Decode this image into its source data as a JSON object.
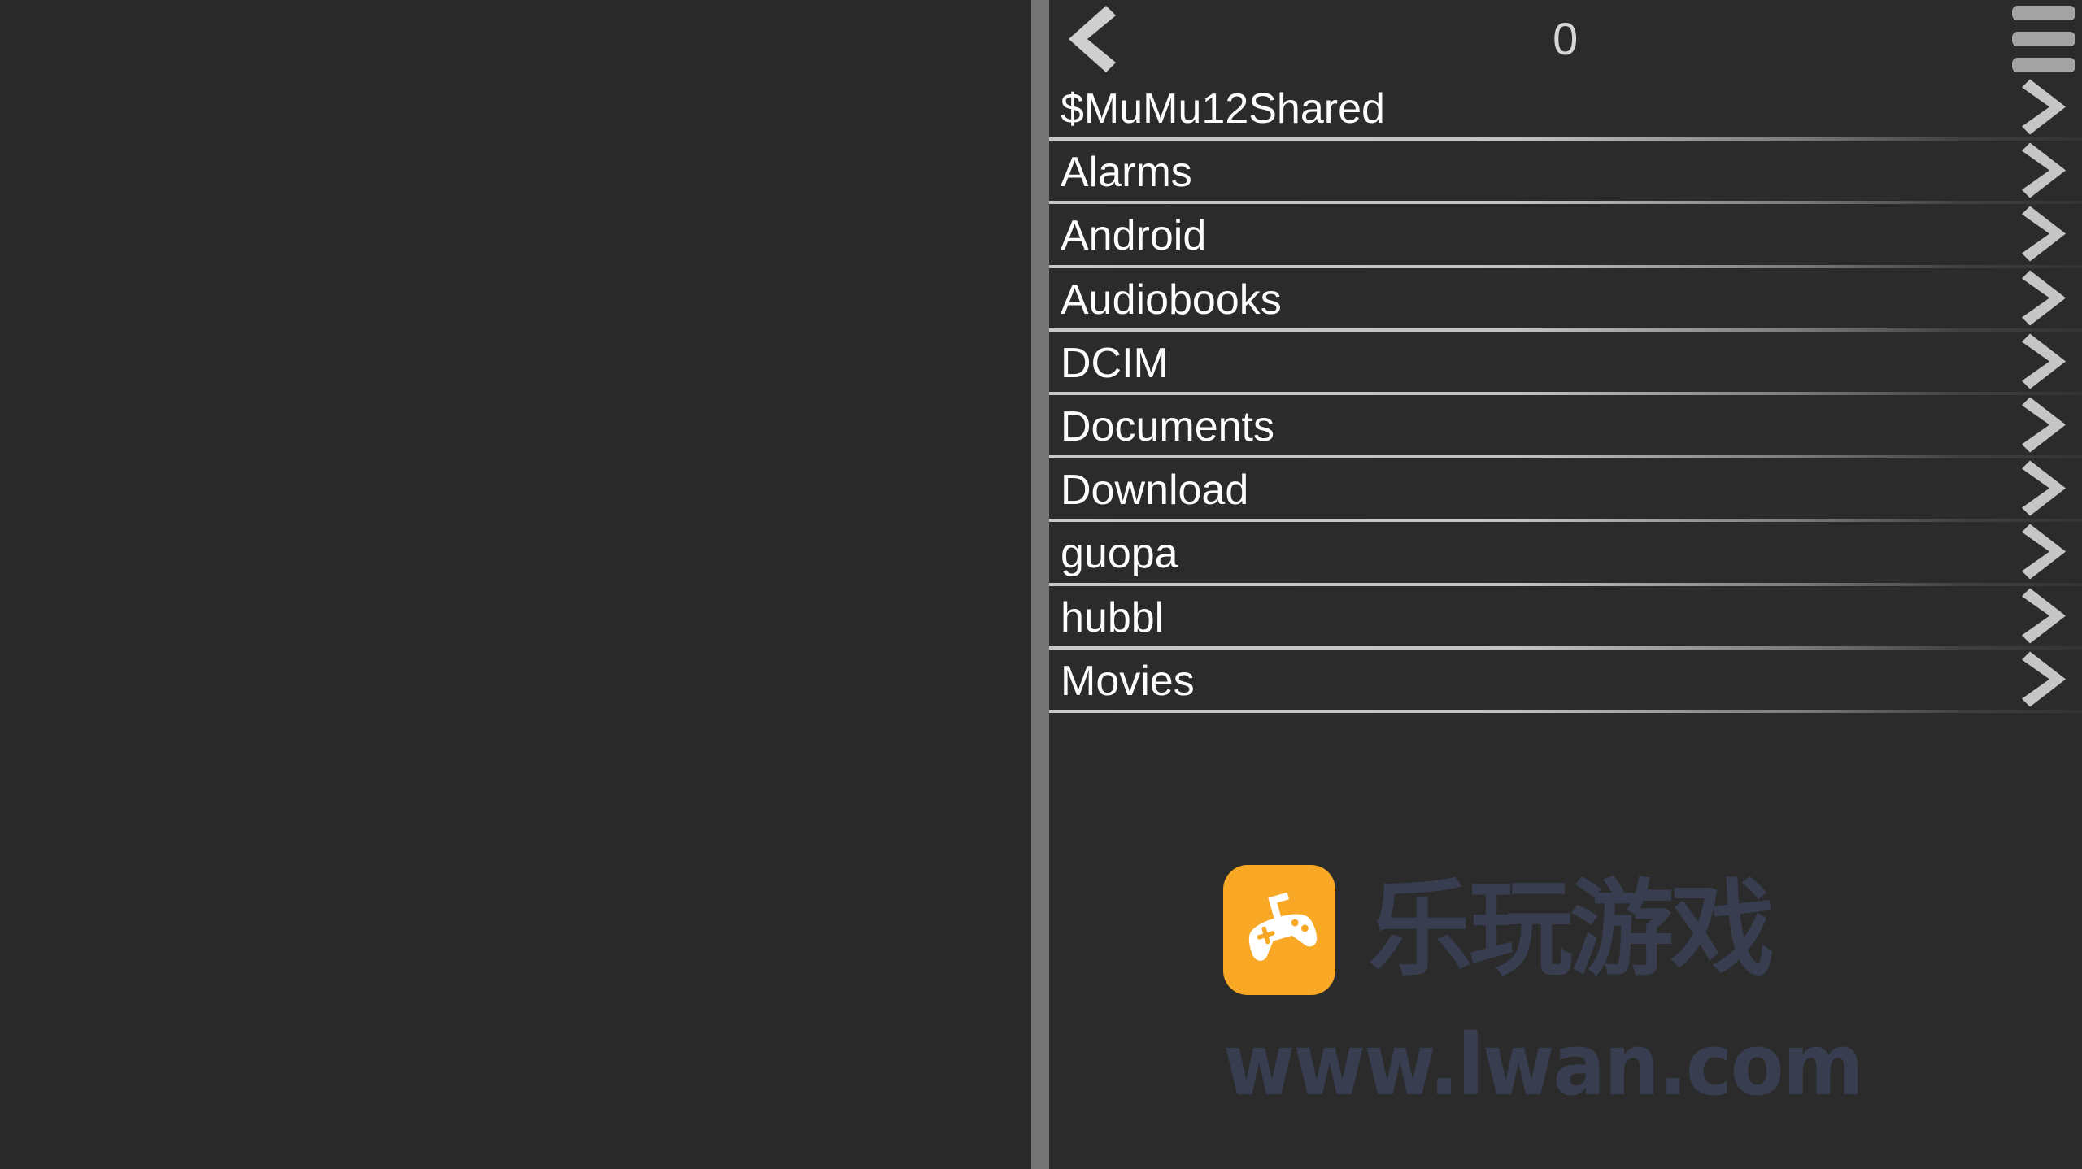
{
  "window": {
    "background_color": "#2a2a2a",
    "panel_color": "#2b2b2b",
    "divider_color": "#757575"
  },
  "left_pane": {
    "name": "empty-pane",
    "content": ""
  },
  "action_bar": {
    "back_icon": "chevron-left-icon",
    "title": "0",
    "menu_icon": "hamburger-menu-icon"
  },
  "file_list": {
    "chevron_icon": "chevron-right-icon",
    "items": [
      {
        "name": "$MuMu12Shared"
      },
      {
        "name": "Alarms"
      },
      {
        "name": "Android"
      },
      {
        "name": "Audiobooks"
      },
      {
        "name": "DCIM"
      },
      {
        "name": "Documents"
      },
      {
        "name": "Download"
      },
      {
        "name": "guopa"
      },
      {
        "name": "hubbl"
      },
      {
        "name": "Movies"
      }
    ]
  },
  "watermark": {
    "icon": "game-controller-icon",
    "icon_color": "#f9a825",
    "brand_text": "乐玩游戏",
    "url_text": "www.lwan.com",
    "text_color": "#3a4054"
  }
}
